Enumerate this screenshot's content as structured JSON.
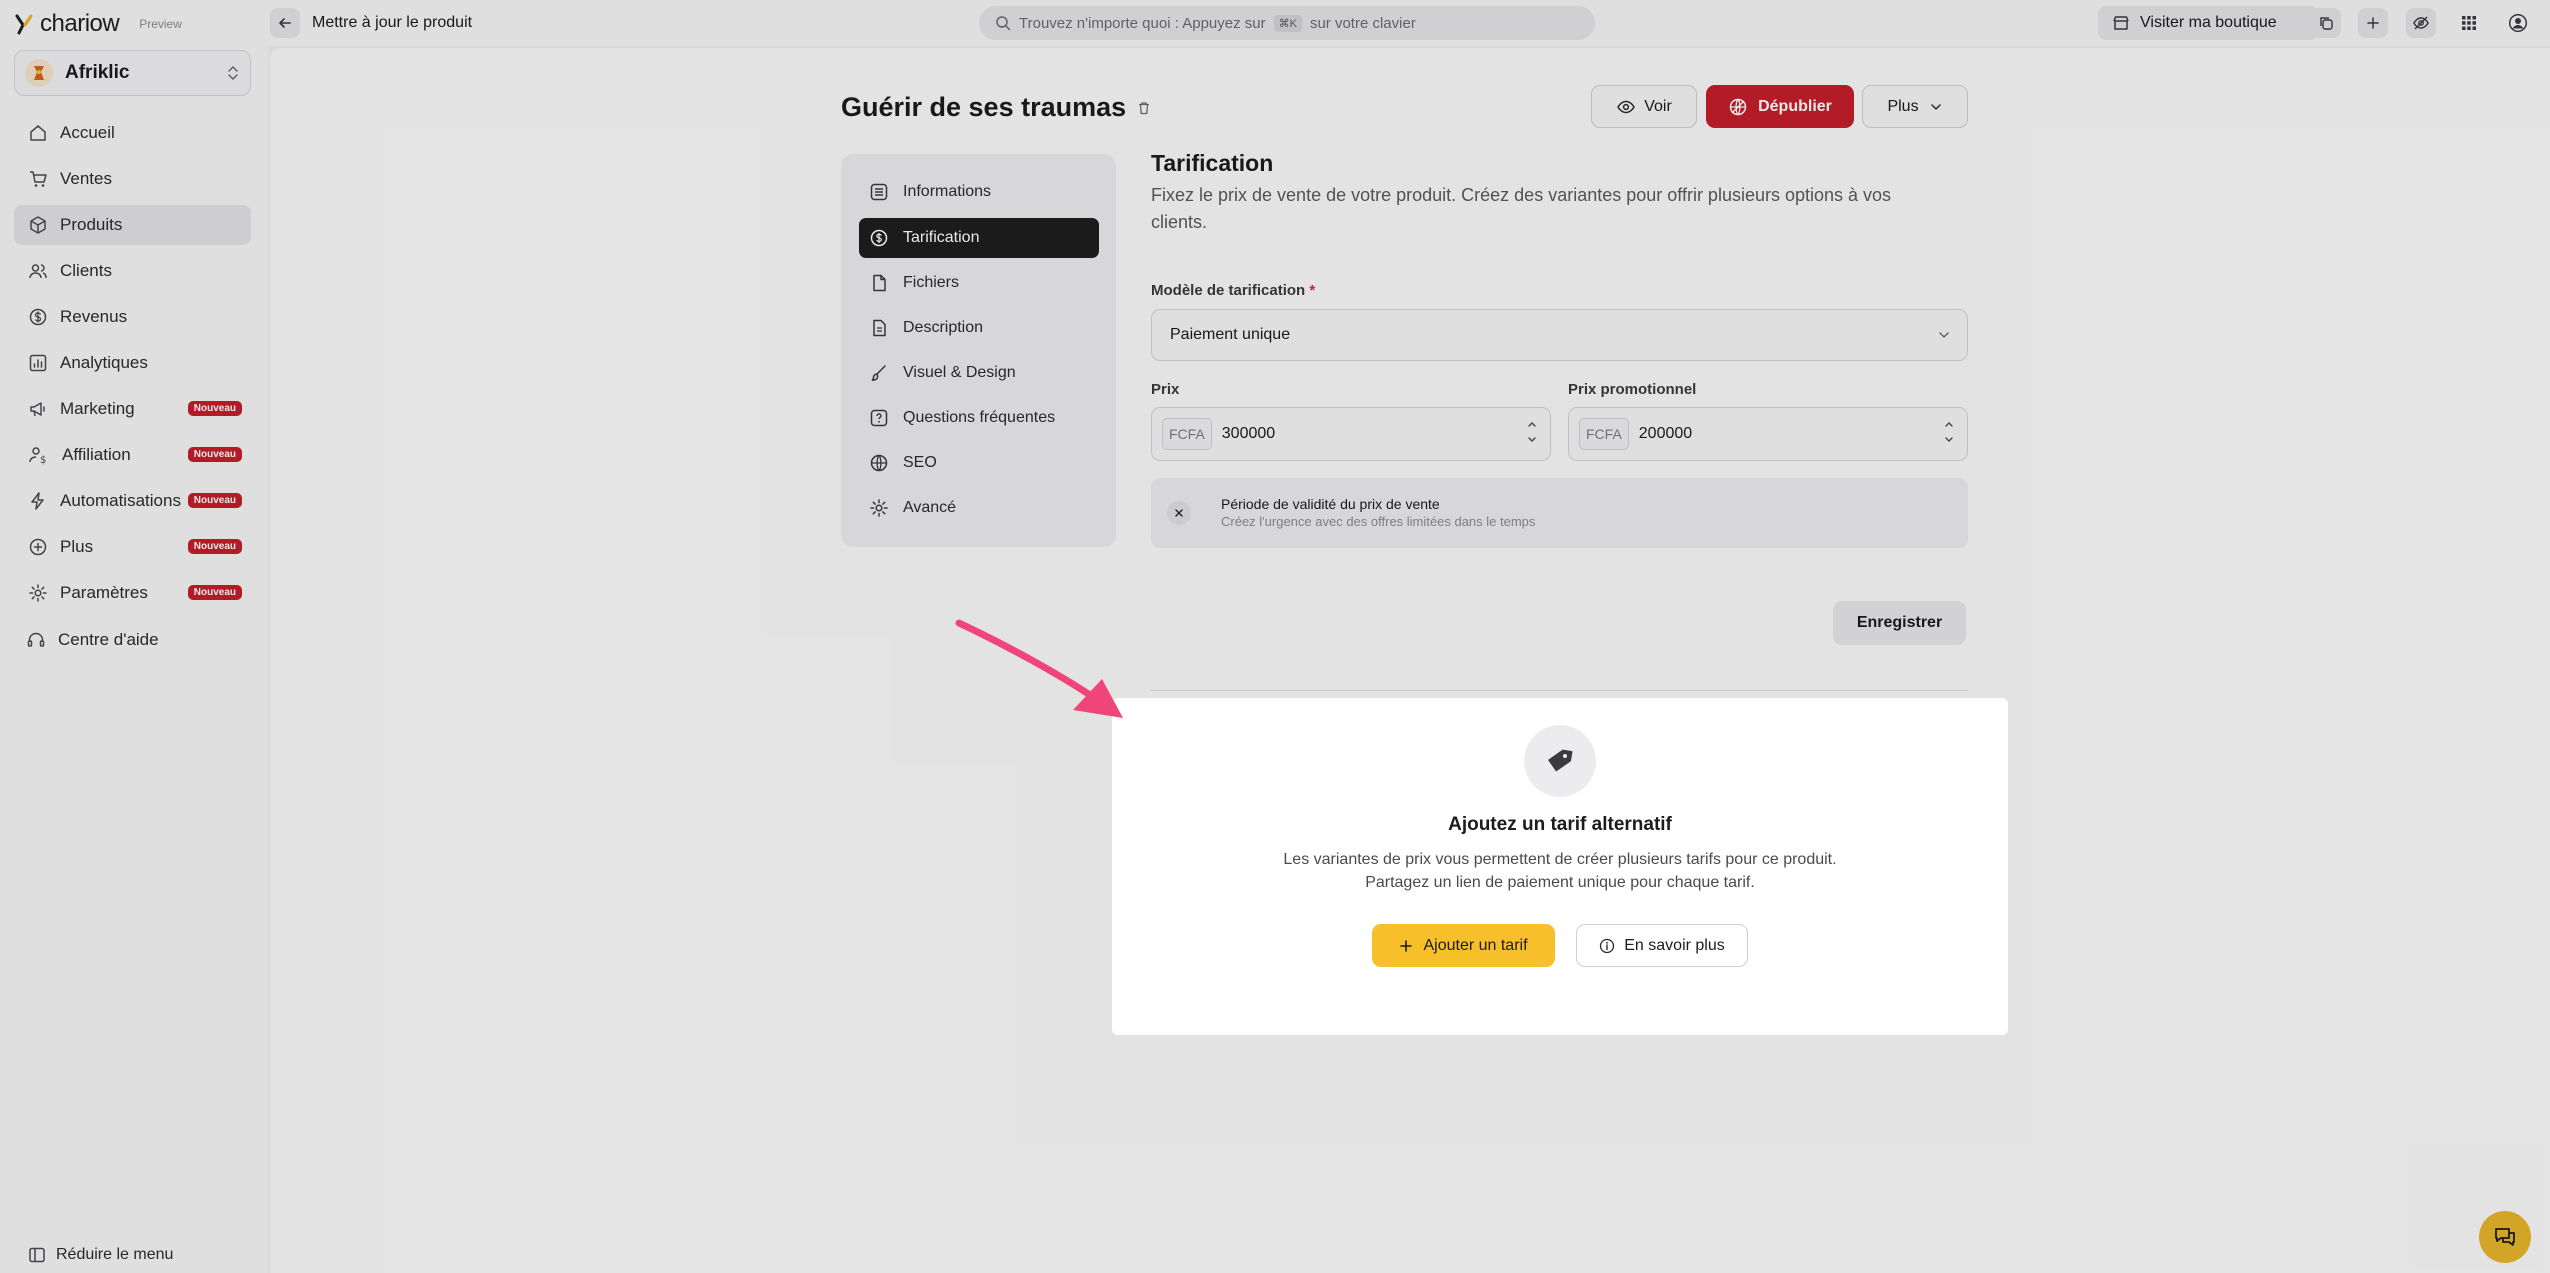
{
  "brand": {
    "name": "chariow",
    "preview_label": "Preview"
  },
  "topbar": {
    "title": "Mettre à jour le produit",
    "search_prefix": "Trouvez n'importe quoi : Appuyez sur",
    "search_kbd": "⌘K",
    "search_suffix": "sur votre clavier",
    "visit_label": "Visiter ma boutique"
  },
  "store": {
    "name": "Afriklic"
  },
  "sidebar": {
    "items": [
      {
        "label": "Accueil",
        "icon": "home-icon",
        "badge": ""
      },
      {
        "label": "Ventes",
        "icon": "cart-icon",
        "badge": ""
      },
      {
        "label": "Produits",
        "icon": "box-icon",
        "badge": "",
        "active": true
      },
      {
        "label": "Clients",
        "icon": "users-icon",
        "badge": ""
      },
      {
        "label": "Revenus",
        "icon": "money-icon",
        "badge": ""
      },
      {
        "label": "Analytiques",
        "icon": "chart-icon",
        "badge": ""
      },
      {
        "label": "Marketing",
        "icon": "megaphone-icon",
        "badge": "Nouveau"
      },
      {
        "label": "Affiliation",
        "icon": "affiliate-icon",
        "badge": "Nouveau"
      },
      {
        "label": "Automatisations",
        "icon": "bolt-icon",
        "badge": "Nouveau"
      },
      {
        "label": "Plus",
        "icon": "plus-circle-icon",
        "badge": "Nouveau"
      },
      {
        "label": "Paramètres",
        "icon": "gear-icon",
        "badge": "Nouveau"
      },
      {
        "label": "Centre d'aide",
        "icon": "headset-icon",
        "badge": ""
      }
    ],
    "collapse_label": "Réduire le menu"
  },
  "product": {
    "title": "Guérir de ses traumas",
    "voir_label": "Voir",
    "depublish_label": "Dépublier",
    "plus_label": "Plus"
  },
  "tabs": [
    {
      "label": "Informations",
      "icon": "list-icon"
    },
    {
      "label": "Tarification",
      "icon": "dollar-circle-icon",
      "active": true
    },
    {
      "label": "Fichiers",
      "icon": "file-icon"
    },
    {
      "label": "Description",
      "icon": "document-icon"
    },
    {
      "label": "Visuel & Design",
      "icon": "brush-icon"
    },
    {
      "label": "Questions fréquentes",
      "icon": "question-icon"
    },
    {
      "label": "SEO",
      "icon": "globe-icon"
    },
    {
      "label": "Avancé",
      "icon": "gear-icon"
    }
  ],
  "pricing": {
    "title": "Tarification",
    "description": "Fixez le prix de vente de votre produit. Créez des variantes pour offrir plusieurs options à vos clients.",
    "model_label": "Modèle de tarification",
    "required_mark": "*",
    "model_value": "Paiement unique",
    "price_label": "Prix",
    "price_currency": "FCFA",
    "price_value": "300000",
    "promo_label": "Prix promotionnel",
    "promo_currency": "FCFA",
    "promo_value": "200000",
    "validity_title": "Période de validité du prix de vente",
    "validity_sub": "Créez l'urgence avec des offres limitées dans le temps",
    "save_label": "Enregistrer"
  },
  "variants": {
    "title": "Ajoutez un tarif alternatif",
    "desc_line1": "Les variantes de prix vous permettent de créer plusieurs tarifs pour ce produit.",
    "desc_line2": "Partagez un lien de paiement unique pour chaque tarif.",
    "add_label": "Ajouter un tarif",
    "learn_label": "En savoir plus"
  },
  "colors": {
    "accent_yellow": "#f7c02b",
    "danger_red": "#c41e2b",
    "annotation_pink": "#f0457a",
    "active_tab": "#1e1e1f"
  }
}
